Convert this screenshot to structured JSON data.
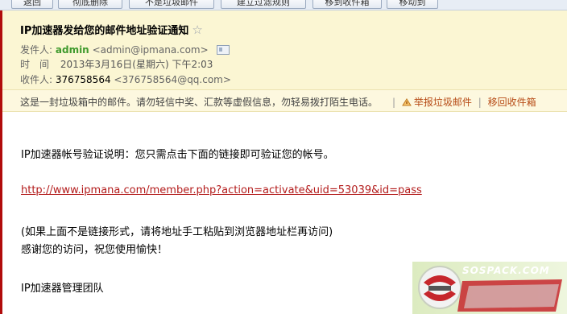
{
  "toolbar": {
    "buttons": [
      "返回",
      "彻底删除",
      "不是垃圾邮件",
      "建立过滤规则",
      "移到收件箱",
      "移动到"
    ]
  },
  "email": {
    "subject": "IP加速器发给您的邮件地址验证通知",
    "from_label": "发件人:",
    "from_name": "admin",
    "from_addr": "<admin@ipmana.com>",
    "time_label": "时　间",
    "time_value": "2013年3月16日(星期六) 下午2:03",
    "to_label": "收件人:",
    "to_name": "376758564",
    "to_addr": "<376758564@qq.com>"
  },
  "spam_notice": {
    "text": "这是一封垃圾箱中的邮件。请勿轻信中奖、汇款等虚假信息，勿轻易拨打陌生电话。",
    "report_link": "举报垃圾邮件",
    "move_link": "移回收件箱"
  },
  "body": {
    "line1": "IP加速器帐号验证说明：您只需点击下面的链接即可验证您的帐号。",
    "link": "http://www.ipmana.com/member.php?action=activate&uid=53039&id=pass",
    "line2": "(如果上面不是链接形式，请将地址手工粘贴到浏览器地址栏再访问)",
    "line3": "感谢您的访问，祝您使用愉快！",
    "signature": "IP加速器管理团队"
  },
  "watermark": {
    "text": "SOSPACK.COM"
  },
  "colors": {
    "header_bg": "#fbf6d3",
    "sender_green": "#3f9a2d",
    "link_red": "#b31b1b",
    "left_border": "#b10c0c"
  }
}
